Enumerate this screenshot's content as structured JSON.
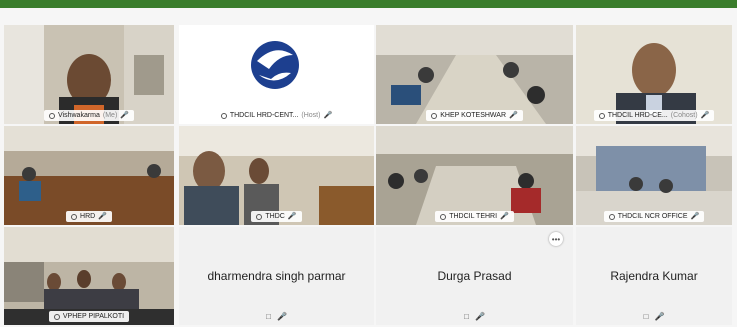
{
  "participants": [
    {
      "label": "Vishwakarma",
      "tag": "(Me)"
    },
    {
      "label": "THDCIL HRD-CENT...",
      "tag": "(Host)"
    },
    {
      "label": "KHEP KOTESHWAR",
      "tag": ""
    },
    {
      "label": "THDCIL HRD-CE...",
      "tag": "(Cohost)"
    },
    {
      "label": "HRD",
      "tag": ""
    },
    {
      "label": "THDC",
      "tag": ""
    },
    {
      "label": "THDCIL TEHRI",
      "tag": ""
    },
    {
      "label": "THDCIL NCR OFFICE",
      "tag": ""
    },
    {
      "label": "VPHEP PIPALKOTI",
      "tag": ""
    }
  ],
  "name_tiles": [
    {
      "name": "dharmendra singh parmar"
    },
    {
      "name": "Durga Prasad"
    },
    {
      "name": "Rajendra Kumar"
    }
  ],
  "icons": {
    "pin": "pin-icon",
    "mic": "mic-muted-icon",
    "more": "more-options-icon",
    "video": "video-off-icon"
  },
  "colors": {
    "accent": "#2aa6d8",
    "topbar": "#3a7d2c",
    "mute": "#d22222"
  }
}
